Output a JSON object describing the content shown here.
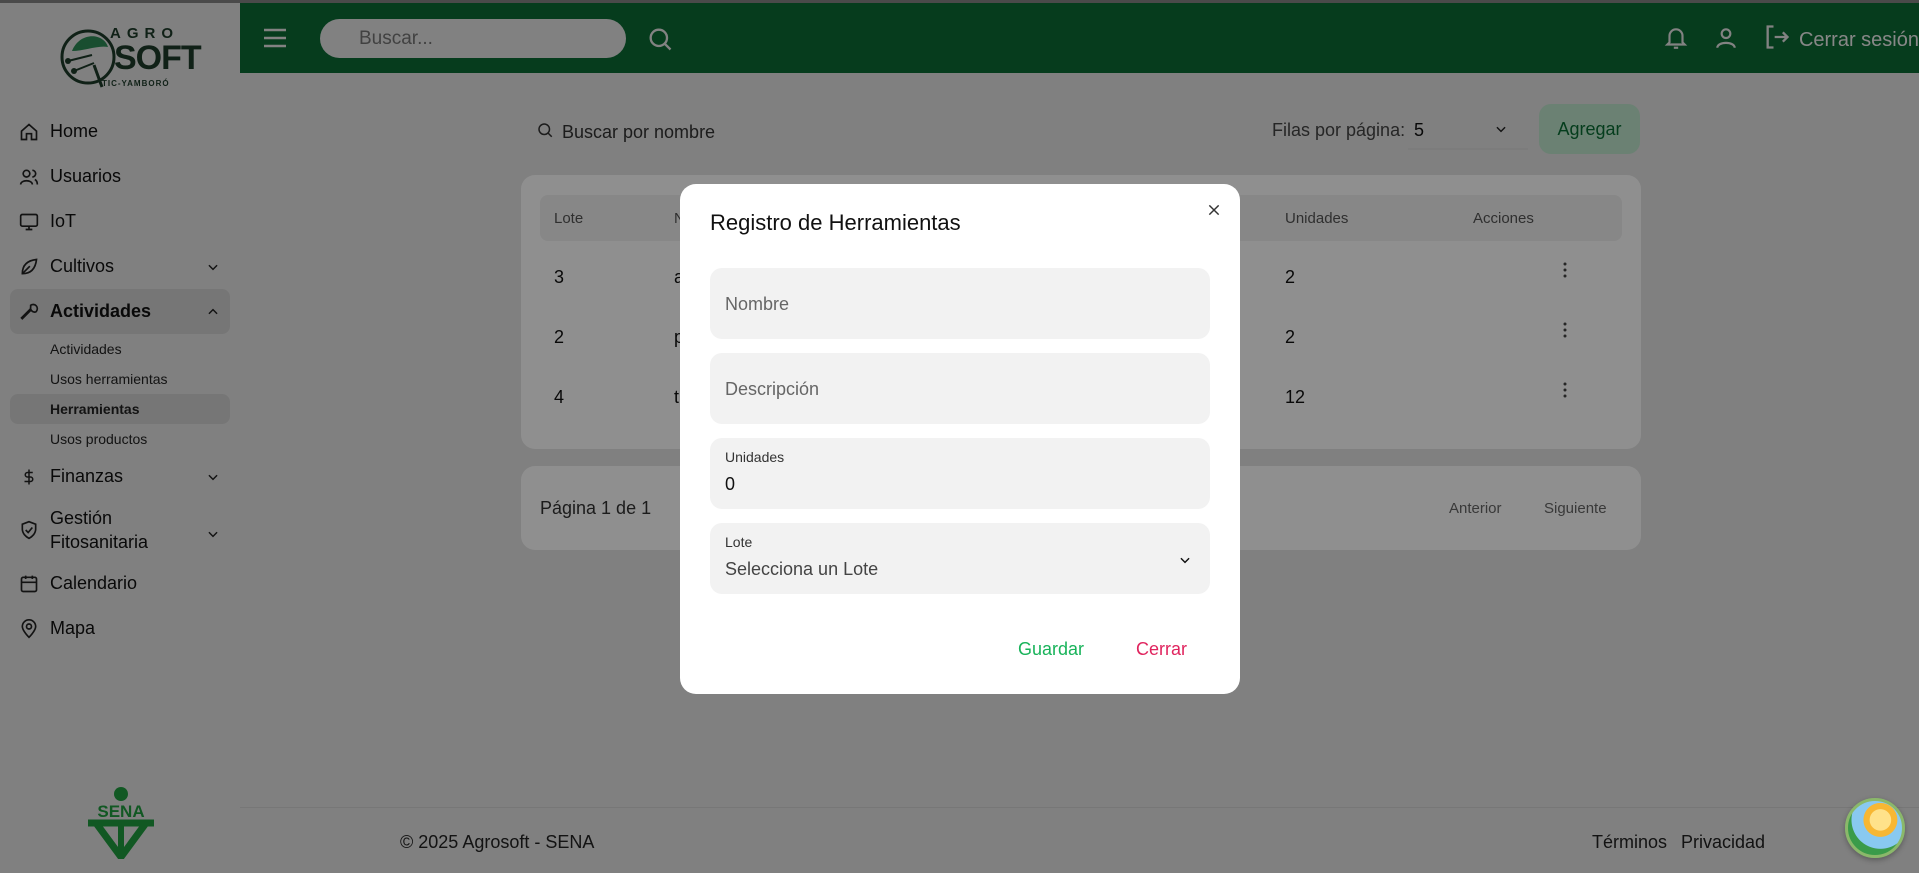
{
  "app": {
    "logo_top": "AGRO",
    "logo_main": "SOFT",
    "logo_sub": "TIC-YAMBORÓ",
    "org_logo_text": "SENA"
  },
  "colors": {
    "header_bg": "#0c6b35",
    "accent_green": "#18b35a",
    "danger_pink": "#e0245e"
  },
  "header": {
    "search_placeholder": "Buscar...",
    "logout_label": "Cerrar sesión"
  },
  "sidebar": {
    "items": [
      {
        "label": "Home",
        "icon": "home-icon"
      },
      {
        "label": "Usuarios",
        "icon": "users-icon"
      },
      {
        "label": "IoT",
        "icon": "monitor-icon"
      },
      {
        "label": "Cultivos",
        "icon": "leaf-icon"
      },
      {
        "label": "Actividades",
        "icon": "wrench-icon"
      },
      {
        "label": "Finanzas",
        "icon": "dollar-icon"
      },
      {
        "label": "Gestión Fitosanitaria",
        "icon": "shield-icon"
      },
      {
        "label": "Calendario",
        "icon": "calendar-icon"
      },
      {
        "label": "Mapa",
        "icon": "map-pin-icon"
      }
    ],
    "sub_items": [
      {
        "label": "Actividades"
      },
      {
        "label": "Usos herramientas"
      },
      {
        "label": "Herramientas"
      },
      {
        "label": "Usos productos"
      }
    ]
  },
  "main": {
    "search_placeholder": "Buscar por nombre",
    "rows_per_page_label": "Filas por página:",
    "rows_per_page_value": "5",
    "add_button": "Agregar",
    "table": {
      "headers": [
        "Lote",
        "N",
        "Unidades",
        "Acciones"
      ],
      "rows": [
        {
          "lote": "3",
          "nombre": "a",
          "unidades": "2"
        },
        {
          "lote": "2",
          "nombre": "p",
          "unidades": "2"
        },
        {
          "lote": "4",
          "nombre": "t",
          "unidades": "12"
        }
      ]
    },
    "pagination": {
      "page_info": "Página 1 de 1",
      "prev": "Anterior",
      "next": "Siguiente"
    }
  },
  "footer": {
    "copyright": "© 2025 Agrosoft - SENA",
    "terms": "Términos",
    "privacy": "Privacidad"
  },
  "modal": {
    "title": "Registro de Herramientas",
    "nombre_placeholder": "Nombre",
    "descripcion_placeholder": "Descripción",
    "unidades_label": "Unidades",
    "unidades_value": "0",
    "lote_label": "Lote",
    "lote_placeholder": "Selecciona un Lote",
    "save_button": "Guardar",
    "close_button": "Cerrar"
  }
}
